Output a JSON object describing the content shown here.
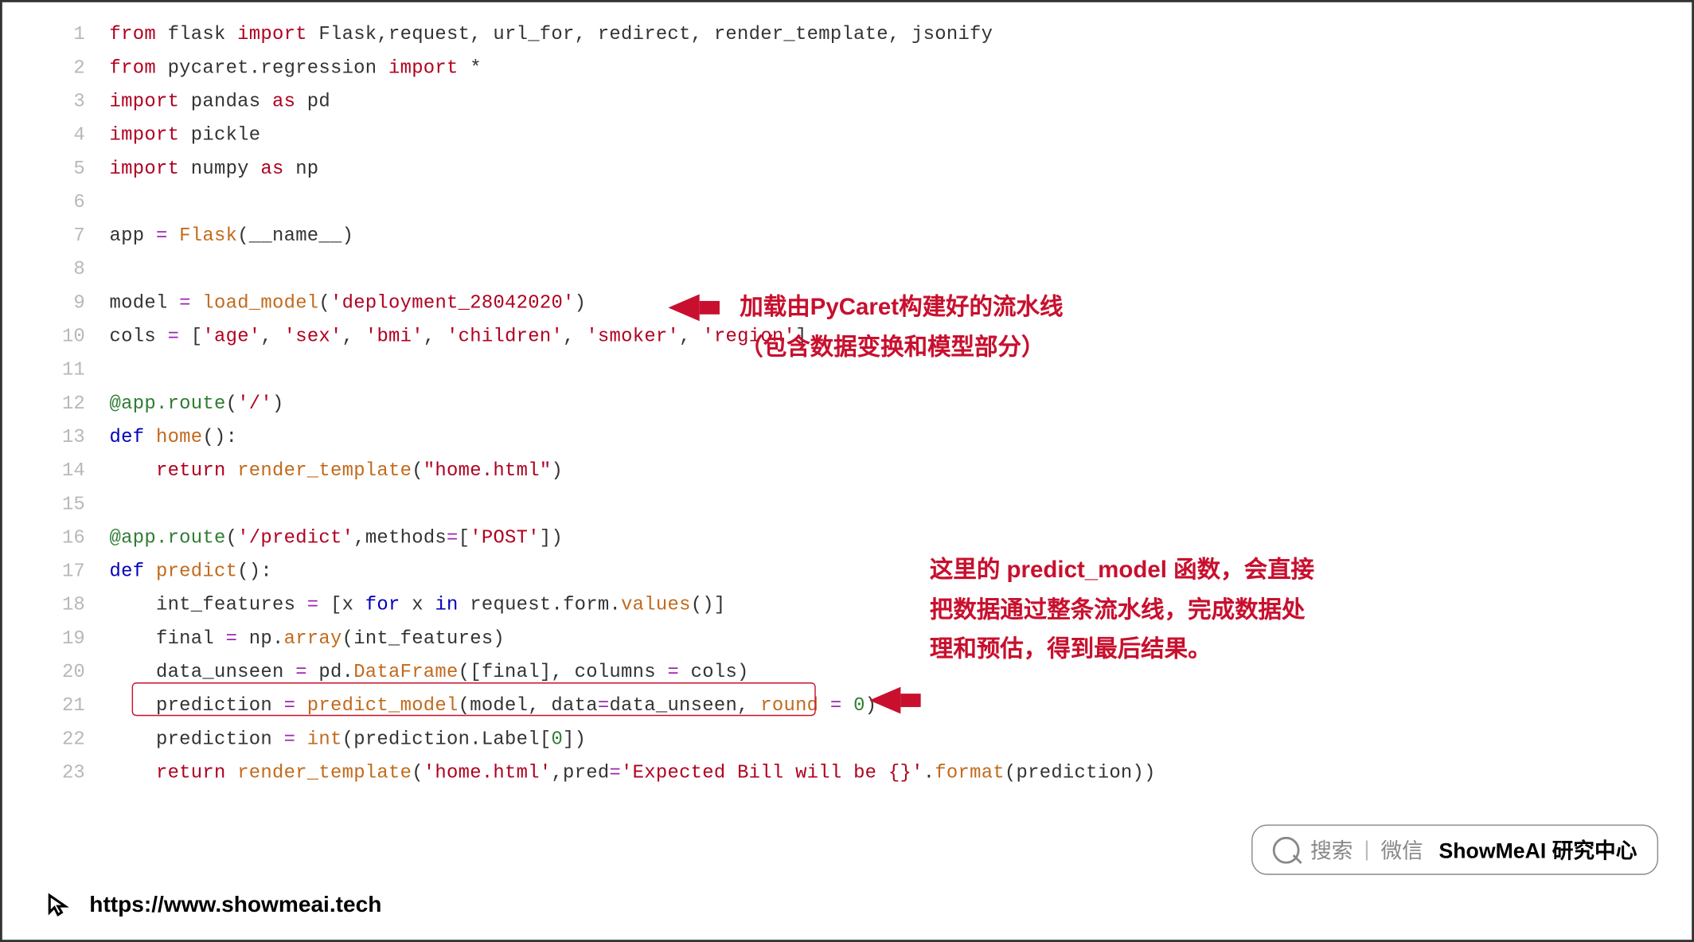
{
  "code": {
    "lines": [
      {
        "n": 1,
        "segs": [
          {
            "c": "k-imp",
            "t": "from"
          },
          {
            "c": "k-id",
            "t": " flask "
          },
          {
            "c": "k-imp",
            "t": "import"
          },
          {
            "c": "k-id",
            "t": " Flask,request, url_for, redirect, render_template, jsonify"
          }
        ]
      },
      {
        "n": 2,
        "segs": [
          {
            "c": "k-imp",
            "t": "from"
          },
          {
            "c": "k-id",
            "t": " pycaret.regression "
          },
          {
            "c": "k-imp",
            "t": "import"
          },
          {
            "c": "k-id",
            "t": " *"
          }
        ]
      },
      {
        "n": 3,
        "segs": [
          {
            "c": "k-imp",
            "t": "import"
          },
          {
            "c": "k-id",
            "t": " pandas "
          },
          {
            "c": "k-imp",
            "t": "as"
          },
          {
            "c": "k-id",
            "t": " pd"
          }
        ]
      },
      {
        "n": 4,
        "segs": [
          {
            "c": "k-imp",
            "t": "import"
          },
          {
            "c": "k-id",
            "t": " pickle"
          }
        ]
      },
      {
        "n": 5,
        "segs": [
          {
            "c": "k-imp",
            "t": "import"
          },
          {
            "c": "k-id",
            "t": " numpy "
          },
          {
            "c": "k-imp",
            "t": "as"
          },
          {
            "c": "k-id",
            "t": " np"
          }
        ]
      },
      {
        "n": 6,
        "segs": []
      },
      {
        "n": 7,
        "segs": [
          {
            "c": "k-id",
            "t": "app "
          },
          {
            "c": "k-op",
            "t": "="
          },
          {
            "c": "k-id",
            "t": " "
          },
          {
            "c": "k-fn",
            "t": "Flask"
          },
          {
            "c": "k-id",
            "t": "(__name__)"
          }
        ]
      },
      {
        "n": 8,
        "segs": []
      },
      {
        "n": 9,
        "segs": [
          {
            "c": "k-id",
            "t": "model "
          },
          {
            "c": "k-op",
            "t": "="
          },
          {
            "c": "k-id",
            "t": " "
          },
          {
            "c": "k-fn",
            "t": "load_model"
          },
          {
            "c": "k-id",
            "t": "("
          },
          {
            "c": "k-str",
            "t": "'deployment_28042020'"
          },
          {
            "c": "k-id",
            "t": ")"
          }
        ]
      },
      {
        "n": 10,
        "segs": [
          {
            "c": "k-id",
            "t": "cols "
          },
          {
            "c": "k-op",
            "t": "="
          },
          {
            "c": "k-id",
            "t": " ["
          },
          {
            "c": "k-str",
            "t": "'age'"
          },
          {
            "c": "k-id",
            "t": ", "
          },
          {
            "c": "k-str",
            "t": "'sex'"
          },
          {
            "c": "k-id",
            "t": ", "
          },
          {
            "c": "k-str",
            "t": "'bmi'"
          },
          {
            "c": "k-id",
            "t": ", "
          },
          {
            "c": "k-str",
            "t": "'children'"
          },
          {
            "c": "k-id",
            "t": ", "
          },
          {
            "c": "k-str",
            "t": "'smoker'"
          },
          {
            "c": "k-id",
            "t": ", "
          },
          {
            "c": "k-str",
            "t": "'region'"
          },
          {
            "c": "k-id",
            "t": "]"
          }
        ]
      },
      {
        "n": 11,
        "segs": []
      },
      {
        "n": 12,
        "segs": [
          {
            "c": "k-dec",
            "t": "@app.route"
          },
          {
            "c": "k-id",
            "t": "("
          },
          {
            "c": "k-str",
            "t": "'/'"
          },
          {
            "c": "k-id",
            "t": ")"
          }
        ]
      },
      {
        "n": 13,
        "segs": [
          {
            "c": "k-def",
            "t": "def "
          },
          {
            "c": "k-fn",
            "t": "home"
          },
          {
            "c": "k-id",
            "t": "():"
          }
        ]
      },
      {
        "n": 14,
        "segs": [
          {
            "c": "k-id",
            "t": "    "
          },
          {
            "c": "k-imp",
            "t": "return"
          },
          {
            "c": "k-id",
            "t": " "
          },
          {
            "c": "k-fn",
            "t": "render_template"
          },
          {
            "c": "k-id",
            "t": "("
          },
          {
            "c": "k-str",
            "t": "\"home.html\""
          },
          {
            "c": "k-id",
            "t": ")"
          }
        ]
      },
      {
        "n": 15,
        "segs": []
      },
      {
        "n": 16,
        "segs": [
          {
            "c": "k-dec",
            "t": "@app.route"
          },
          {
            "c": "k-id",
            "t": "("
          },
          {
            "c": "k-str",
            "t": "'/predict'"
          },
          {
            "c": "k-id",
            "t": ",methods"
          },
          {
            "c": "k-op",
            "t": "="
          },
          {
            "c": "k-id",
            "t": "["
          },
          {
            "c": "k-str",
            "t": "'POST'"
          },
          {
            "c": "k-id",
            "t": "])"
          }
        ]
      },
      {
        "n": 17,
        "segs": [
          {
            "c": "k-def",
            "t": "def "
          },
          {
            "c": "k-fn",
            "t": "predict"
          },
          {
            "c": "k-id",
            "t": "():"
          }
        ]
      },
      {
        "n": 18,
        "segs": [
          {
            "c": "k-id",
            "t": "    int_features "
          },
          {
            "c": "k-op",
            "t": "="
          },
          {
            "c": "k-id",
            "t": " [x "
          },
          {
            "c": "k-def",
            "t": "for"
          },
          {
            "c": "k-id",
            "t": " x "
          },
          {
            "c": "k-def",
            "t": "in"
          },
          {
            "c": "k-id",
            "t": " request.form."
          },
          {
            "c": "k-fn",
            "t": "values"
          },
          {
            "c": "k-id",
            "t": "()]"
          }
        ]
      },
      {
        "n": 19,
        "segs": [
          {
            "c": "k-id",
            "t": "    final "
          },
          {
            "c": "k-op",
            "t": "="
          },
          {
            "c": "k-id",
            "t": " np."
          },
          {
            "c": "k-fn",
            "t": "array"
          },
          {
            "c": "k-id",
            "t": "(int_features)"
          }
        ]
      },
      {
        "n": 20,
        "segs": [
          {
            "c": "k-id",
            "t": "    data_unseen "
          },
          {
            "c": "k-op",
            "t": "="
          },
          {
            "c": "k-id",
            "t": " pd."
          },
          {
            "c": "k-fn",
            "t": "DataFrame"
          },
          {
            "c": "k-id",
            "t": "([final], columns "
          },
          {
            "c": "k-op",
            "t": "="
          },
          {
            "c": "k-id",
            "t": " cols)"
          }
        ]
      },
      {
        "n": 21,
        "segs": [
          {
            "c": "k-id",
            "t": "    prediction "
          },
          {
            "c": "k-op",
            "t": "="
          },
          {
            "c": "k-id",
            "t": " "
          },
          {
            "c": "k-fn",
            "t": "predict_model"
          },
          {
            "c": "k-id",
            "t": "(model, data"
          },
          {
            "c": "k-op",
            "t": "="
          },
          {
            "c": "k-id",
            "t": "data_unseen, "
          },
          {
            "c": "k-fn",
            "t": "round"
          },
          {
            "c": "k-id",
            "t": " "
          },
          {
            "c": "k-op",
            "t": "="
          },
          {
            "c": "k-id",
            "t": " "
          },
          {
            "c": "k-num",
            "t": "0"
          },
          {
            "c": "k-id",
            "t": ")"
          }
        ]
      },
      {
        "n": 22,
        "segs": [
          {
            "c": "k-id",
            "t": "    prediction "
          },
          {
            "c": "k-op",
            "t": "="
          },
          {
            "c": "k-id",
            "t": " "
          },
          {
            "c": "k-fn",
            "t": "int"
          },
          {
            "c": "k-id",
            "t": "(prediction.Label["
          },
          {
            "c": "k-num",
            "t": "0"
          },
          {
            "c": "k-id",
            "t": "])"
          }
        ]
      },
      {
        "n": 23,
        "segs": [
          {
            "c": "k-id",
            "t": "    "
          },
          {
            "c": "k-imp",
            "t": "return"
          },
          {
            "c": "k-id",
            "t": " "
          },
          {
            "c": "k-fn",
            "t": "render_template"
          },
          {
            "c": "k-id",
            "t": "("
          },
          {
            "c": "k-str",
            "t": "'home.html'"
          },
          {
            "c": "k-id",
            "t": ",pred"
          },
          {
            "c": "k-op",
            "t": "="
          },
          {
            "c": "k-str",
            "t": "'Expected Bill will be {}'"
          },
          {
            "c": "k-id",
            "t": "."
          },
          {
            "c": "k-fn",
            "t": "format"
          },
          {
            "c": "k-id",
            "t": "(prediction))"
          }
        ]
      }
    ]
  },
  "annotations": {
    "a1_line1": "加载由PyCaret构建好的流水线",
    "a1_line2": "（包含数据变换和模型部分）",
    "a2_line1": "这里的 predict_model 函数，会直接",
    "a2_line2": "把数据通过整条流水线，完成数据处",
    "a2_line3": "理和预估，得到最后结果。"
  },
  "search_badge": {
    "search_label": "搜索",
    "sub_label": "微信",
    "brand": "ShowMeAI 研究中心"
  },
  "footer": {
    "url": "https://www.showmeai.tech"
  }
}
